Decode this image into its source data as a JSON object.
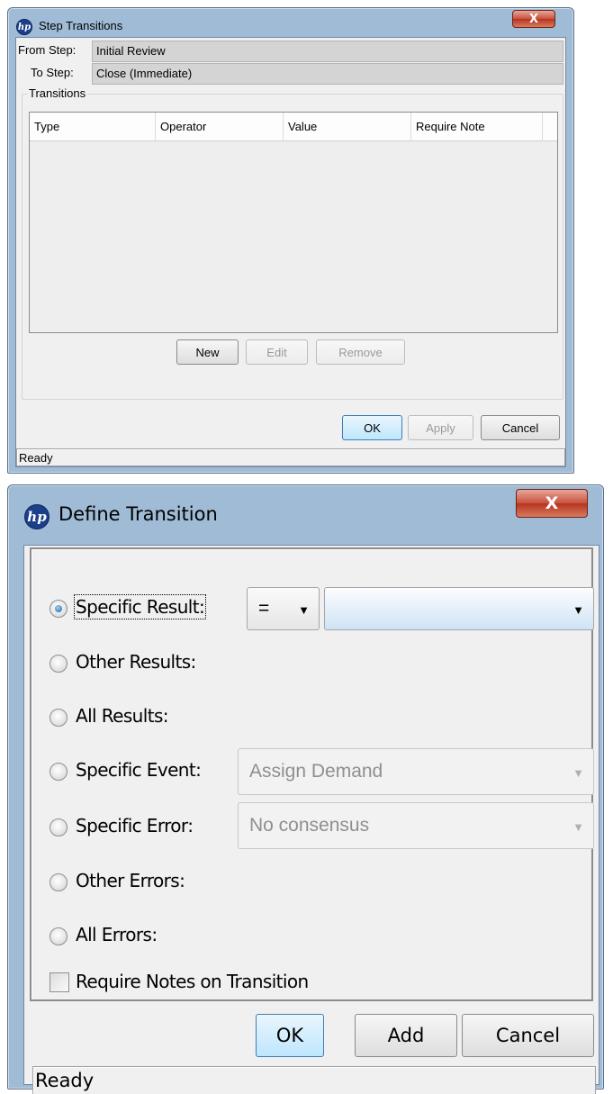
{
  "step_transitions": {
    "title": "Step Transitions",
    "close_label": "X",
    "from_step_label": "From Step:",
    "from_step_value": "Initial Review",
    "to_step_label": "To Step:",
    "to_step_value": "Close (Immediate)",
    "transitions_group": "Transitions",
    "columns": [
      "Type",
      "Operator",
      "Value",
      "Require Note"
    ],
    "rows": [],
    "buttons": {
      "new": "New",
      "edit": "Edit",
      "remove": "Remove",
      "ok": "OK",
      "apply": "Apply",
      "cancel": "Cancel"
    },
    "status": "Ready"
  },
  "define_transition": {
    "title": "Define Transition",
    "close_label": "X",
    "options": {
      "specific_result": "Specific Result:",
      "other_results": "Other Results:",
      "all_results": "All Results:",
      "specific_event": "Specific Event:",
      "specific_error": "Specific Error:",
      "other_errors": "Other Errors:",
      "all_errors": "All Errors:"
    },
    "selected_option": "specific_result",
    "operator_value": "=",
    "result_value": "",
    "event_value": "Assign Demand",
    "error_value": "No consensus",
    "require_notes_label": "Require Notes on Transition",
    "require_notes_checked": false,
    "buttons": {
      "ok": "OK",
      "add": "Add",
      "cancel": "Cancel"
    },
    "status": "Ready"
  },
  "icons": {
    "app": "hp-logo-icon",
    "close": "close-icon",
    "dropdown": "chevron-down-icon"
  },
  "colors": {
    "title_bar": "#9fbbd6",
    "close_button": "#c8503a",
    "selection_bar": "#cfe3f5"
  }
}
